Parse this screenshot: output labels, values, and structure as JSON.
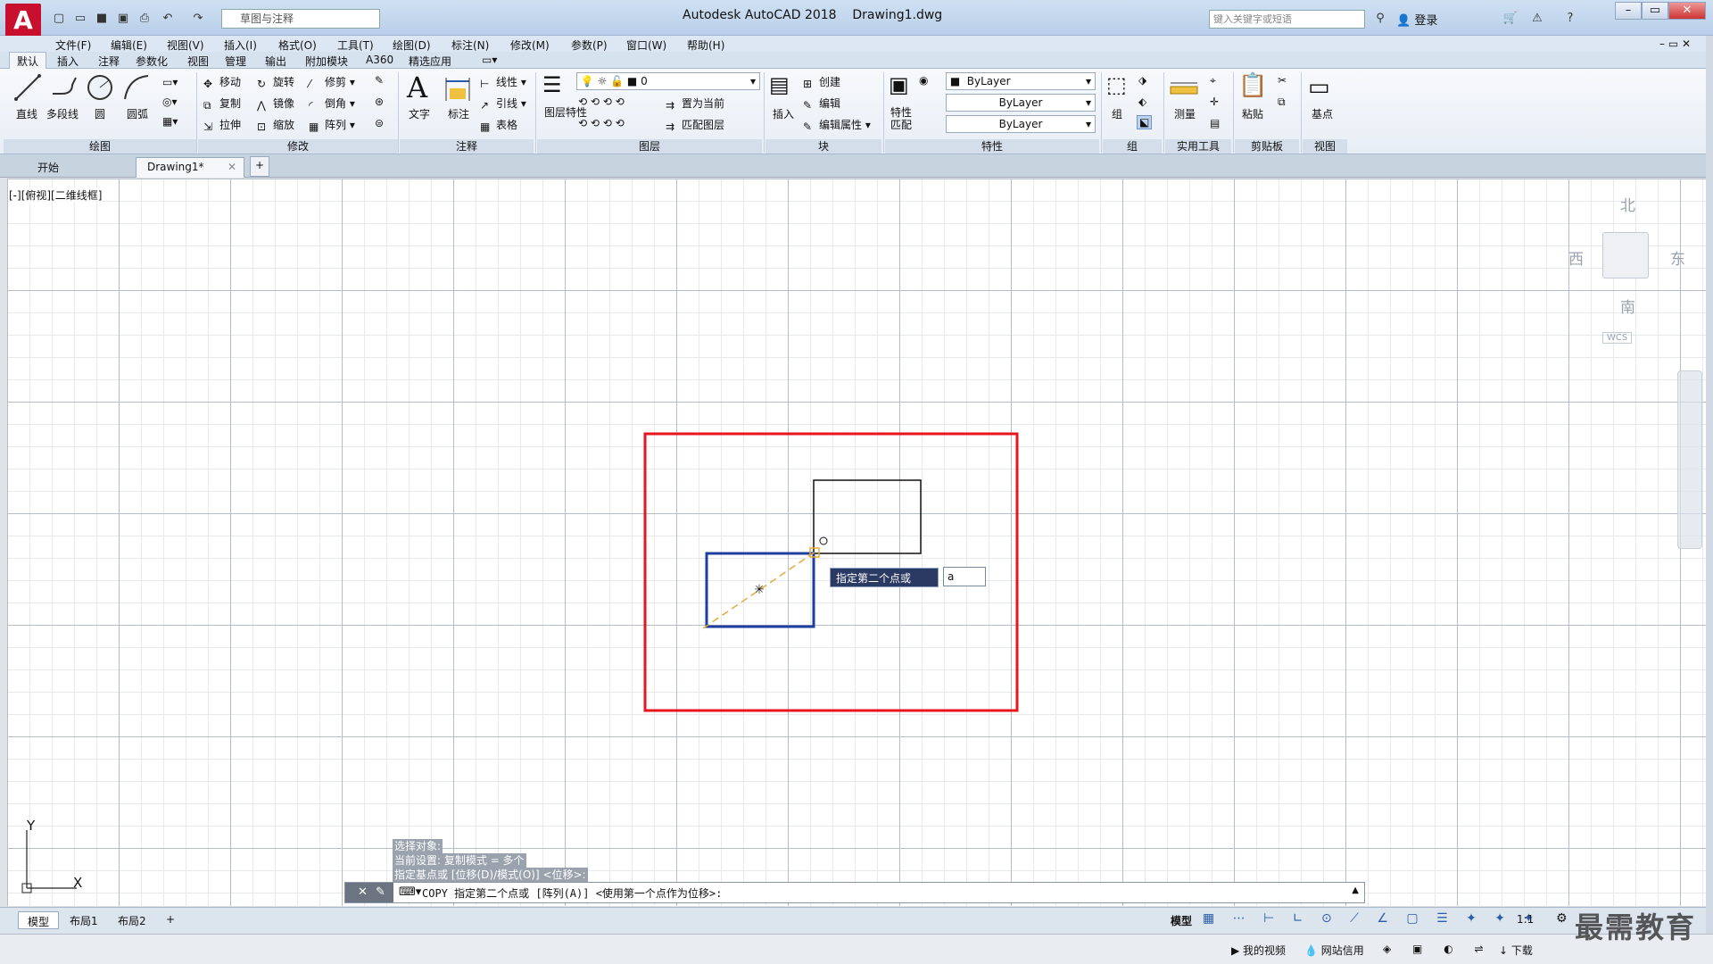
{
  "titlebar": {
    "app_title": "Autodesk AutoCAD 2018",
    "document": "Drawing1.dwg",
    "workspace": "草图与注释",
    "search_placeholder": "键入关键字或短语",
    "login": "登录"
  },
  "menu": [
    "文件(F)",
    "编辑(E)",
    "视图(V)",
    "插入(I)",
    "格式(O)",
    "工具(T)",
    "绘图(D)",
    "标注(N)",
    "修改(M)",
    "参数(P)",
    "窗口(W)",
    "帮助(H)"
  ],
  "ribbon_tabs": [
    "默认",
    "插入",
    "注释",
    "参数化",
    "视图",
    "管理",
    "输出",
    "附加模块",
    "A360",
    "精选应用"
  ],
  "ribbon": {
    "draw": {
      "title": "绘图",
      "line": "直线",
      "polyline": "多段线",
      "circle": "圆",
      "arc": "圆弧"
    },
    "modify": {
      "title": "修改",
      "move": "移动",
      "rotate": "旋转",
      "trim": "修剪",
      "copy": "复制",
      "mirror": "镜像",
      "fillet": "倒角",
      "stretch": "拉伸",
      "scale": "缩放",
      "array": "阵列"
    },
    "annotation": {
      "title": "注释",
      "text": "文字",
      "dimension": "标注",
      "linear": "线性",
      "leader": "引线",
      "table": "表格"
    },
    "layers": {
      "title": "图层",
      "layer_props": "图层特性",
      "current_layer": "0",
      "set_current": "置为当前",
      "match_layer": "匹配图层"
    },
    "block": {
      "title": "块",
      "insert": "插入",
      "create": "创建",
      "edit": "编辑",
      "edit_attr": "编辑属性"
    },
    "properties": {
      "title": "特性",
      "match": "特性匹配",
      "color": "ByLayer",
      "linetype": "ByLayer",
      "lineweight": "ByLayer"
    },
    "groups": {
      "title": "组",
      "group": "组"
    },
    "utilities": {
      "title": "实用工具",
      "measure": "测量"
    },
    "clipboard": {
      "title": "剪贴板",
      "paste": "粘贴"
    },
    "view": {
      "title": "视图",
      "base": "基点"
    }
  },
  "file_tabs": {
    "start": "开始",
    "drawing": "Drawing1*"
  },
  "canvas": {
    "view_label": "[-][俯视][二维线框]",
    "viewcube": {
      "north": "北",
      "south": "南",
      "east": "东",
      "west": "西",
      "wcs": "WCS"
    },
    "tooltip": "指定第二个点或",
    "dynamic_input": "a",
    "ucs_x": "X",
    "ucs_y": "Y"
  },
  "command": {
    "history": [
      "选择对象:",
      "当前设置:  复制模式 = 多个",
      "指定基点或 [位移(D)/模式(O)] <位移>:"
    ],
    "current": "COPY 指定第二个点或 [阵列(A)] <使用第一个点作为位移>:"
  },
  "layouts": [
    "模型",
    "布局1",
    "布局2"
  ],
  "status": {
    "model": "模型",
    "scale": "1:1"
  },
  "taskbar": {
    "my_video": "我的视频",
    "net_credit": "网站信用",
    "download": "下载"
  },
  "watermark": "最需教育",
  "colors": {
    "highlight_rect": "#e8141e",
    "selected_rect": "#1f3fa0",
    "rubberband": "#e8a83a"
  }
}
